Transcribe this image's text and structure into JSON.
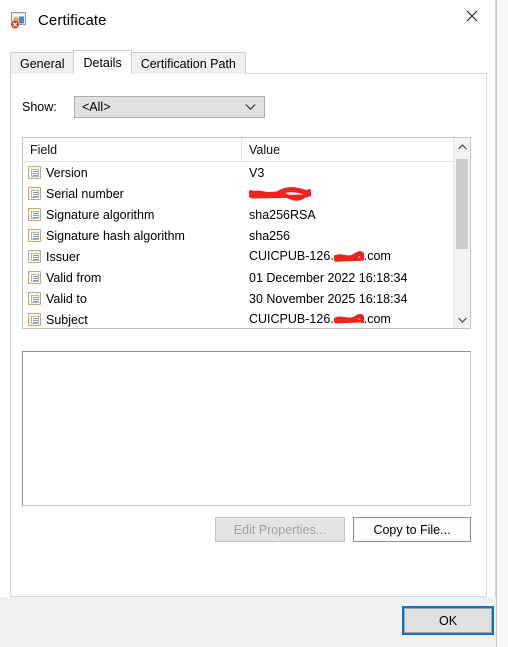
{
  "window": {
    "title": "Certificate",
    "icon": "certificate-error-icon",
    "close_label": "✕"
  },
  "tabs": [
    {
      "label": "General",
      "active": false
    },
    {
      "label": "Details",
      "active": true
    },
    {
      "label": "Certification Path",
      "active": false
    }
  ],
  "show": {
    "label": "Show:",
    "value": "<All>",
    "options": [
      "<All>"
    ]
  },
  "field_list": {
    "columns": [
      "Field",
      "Value"
    ],
    "rows": [
      {
        "field": "Version",
        "value": "V3",
        "redacted": "none"
      },
      {
        "field": "Serial number",
        "value": "",
        "redacted": "full"
      },
      {
        "field": "Signature algorithm",
        "value": "sha256RSA",
        "redacted": "none"
      },
      {
        "field": "Signature hash algorithm",
        "value": "sha256",
        "redacted": "none"
      },
      {
        "field": "Issuer",
        "value_prefix": "CUICPUB-126.",
        "value_suffix": ".com",
        "redacted": "partial"
      },
      {
        "field": "Valid from",
        "value": "01 December 2022 16:18:34",
        "redacted": "none"
      },
      {
        "field": "Valid to",
        "value": "30 November 2025 16:18:34",
        "redacted": "none"
      },
      {
        "field": "Subject",
        "value_prefix": "CUICPUB-126.",
        "value_suffix": ".com",
        "redacted": "partial"
      }
    ]
  },
  "detail": {
    "text": ""
  },
  "buttons": {
    "edit_properties": "Edit Properties...",
    "copy_to_file": "Copy to File...",
    "ok": "OK"
  },
  "colors": {
    "redaction": "#e8251f",
    "focus": "#0078d7",
    "dialog_bg": "#ffffff",
    "footer_bg": "#f0f0f0"
  }
}
